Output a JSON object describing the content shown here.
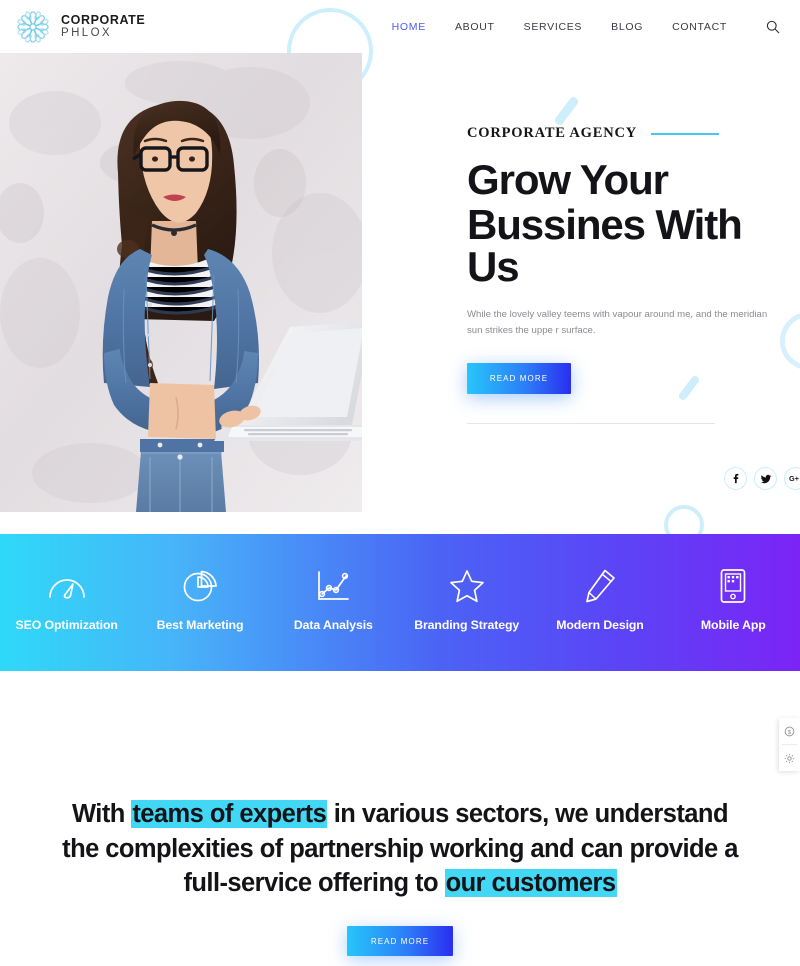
{
  "header": {
    "logo": {
      "icon": "mandala-flower-logo-icon",
      "line1": "CORPORATE",
      "line2": "PHLOX"
    },
    "nav": [
      {
        "label": "HOME",
        "active": true
      },
      {
        "label": "ABOUT",
        "active": false
      },
      {
        "label": "SERVICES",
        "active": false
      },
      {
        "label": "BLOG",
        "active": false
      },
      {
        "label": "CONTACT",
        "active": false
      }
    ],
    "search_icon": "search-icon"
  },
  "hero": {
    "eyebrow": "CORPORATE AGENCY",
    "title_line1": "Grow Your",
    "title_line2": "Bussines With Us",
    "subtitle": "While the lovely valley teems with vapour around me, and the meridian sun strikes the uppe r surface.",
    "cta_label": "READ MORE",
    "photo_alt": "woman-with-laptop-photo",
    "socials": [
      {
        "name": "facebook",
        "glyph": "f"
      },
      {
        "name": "twitter",
        "glyph": "t"
      },
      {
        "name": "google-plus",
        "glyph": "G+"
      }
    ]
  },
  "services": [
    {
      "label": "SEO Optimization",
      "icon": "speedometer-icon"
    },
    {
      "label": "Best Marketing",
      "icon": "pie-chart-icon"
    },
    {
      "label": "Data Analysis",
      "icon": "line-graph-icon"
    },
    {
      "label": "Branding Strategy",
      "icon": "star-icon"
    },
    {
      "label": "Modern Design",
      "icon": "pencil-icon"
    },
    {
      "label": "Mobile App",
      "icon": "tablet-icon"
    }
  ],
  "cta": {
    "part1": "With ",
    "highlight1": "teams of experts",
    "part2": " in various sectors, we understand the complexities of partnership working and can provide a full-service offering to ",
    "highlight2": "our customers",
    "button_label": "READ MORE"
  },
  "side_widget": {
    "buttons": [
      {
        "name": "currency-icon"
      },
      {
        "name": "settings-gear-icon"
      }
    ]
  },
  "colors": {
    "accent_blue": "#4e5bf2",
    "accent_cyan": "#41d7f5",
    "deco_light": "#cdeefb",
    "gradient_start": "#2fd9f8",
    "gradient_mid": "#4b63f5",
    "gradient_end": "#7b24f6",
    "text_dark": "#141418",
    "text_muted": "#8b8b96"
  }
}
